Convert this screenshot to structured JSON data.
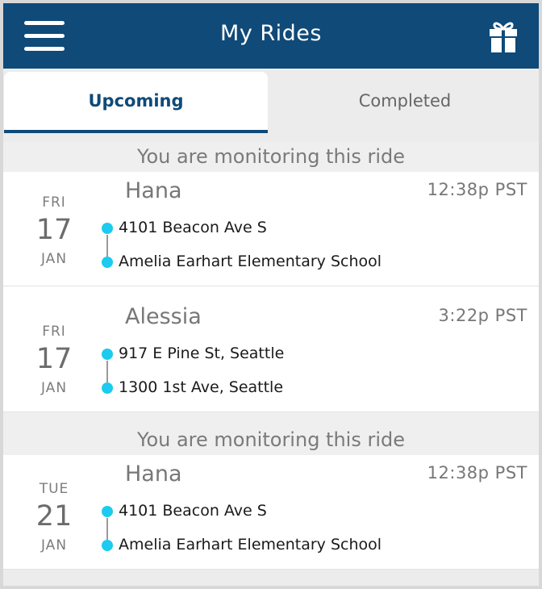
{
  "header": {
    "title": "My Rides",
    "menu_icon": "hamburger-menu-icon",
    "gift_icon": "gift-icon",
    "bar_color": "#0f4a78"
  },
  "tabs": [
    {
      "label": "Upcoming",
      "active": true
    },
    {
      "label": "Completed",
      "active": false
    }
  ],
  "rides": [
    {
      "monitoring_banner": "You are monitoring this ride",
      "rider": "Hana",
      "time": "12:38p PST",
      "date": {
        "dow": "FRI",
        "day": "17",
        "month": "JAN"
      },
      "pickup": "4101 Beacon Ave S",
      "dropoff": "Amelia Earhart Elementary School"
    },
    {
      "monitoring_banner": "",
      "rider": "Alessia",
      "time": "3:22p PST",
      "date": {
        "dow": "FRI",
        "day": "17",
        "month": "JAN"
      },
      "pickup": "917 E Pine St, Seattle",
      "dropoff": "1300 1st Ave, Seattle"
    },
    {
      "monitoring_banner": "You are monitoring this ride",
      "rider": "Hana",
      "time": "12:38p PST",
      "date": {
        "dow": "TUE",
        "day": "21",
        "month": "JAN"
      },
      "pickup": "4101 Beacon Ave S",
      "dropoff": "Amelia Earhart Elementary School"
    }
  ],
  "accent_colors": {
    "stop_dot": "#1ccbef"
  }
}
